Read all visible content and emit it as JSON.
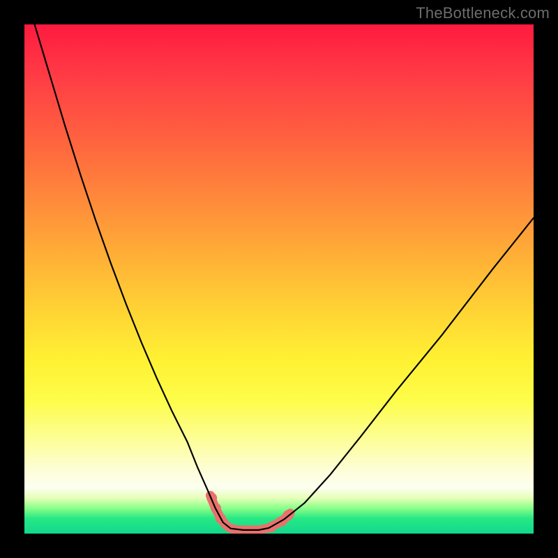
{
  "watermark": "TheBottleneck.com",
  "chart_data": {
    "type": "line",
    "title": "",
    "xlabel": "",
    "ylabel": "",
    "xlim": [
      0,
      100
    ],
    "ylim": [
      0,
      100
    ],
    "grid": false,
    "legend": false,
    "series": [
      {
        "name": "bottleneck-curve",
        "style": "thin-black",
        "x": [
          2,
          5,
          8,
          11,
          14,
          17,
          20,
          23,
          26,
          29,
          32,
          34,
          36,
          37.5,
          39,
          40.5,
          43,
          46,
          48,
          51,
          55,
          60,
          66,
          73,
          82,
          92,
          100
        ],
        "values": [
          100,
          90,
          80,
          70.5,
          61.5,
          53,
          45,
          37.5,
          30.5,
          24,
          18,
          13,
          8.5,
          5,
          2.2,
          1.0,
          0.7,
          0.7,
          1.1,
          2.8,
          6,
          11.5,
          19,
          28,
          39,
          52,
          62
        ]
      },
      {
        "name": "highlight-band",
        "style": "thick-salmon",
        "x": [
          36.5,
          37.5,
          38.5,
          39.5,
          40.5,
          42,
          44,
          46,
          48,
          49.5,
          51,
          52.2
        ],
        "values": [
          7.5,
          5,
          3.1,
          1.7,
          1.0,
          0.7,
          0.7,
          0.7,
          1.1,
          1.9,
          2.8,
          4.0
        ]
      }
    ],
    "markers": [
      {
        "x": 36.8,
        "y": 7.0
      },
      {
        "x": 37.6,
        "y": 5.0
      },
      {
        "x": 38.5,
        "y": 3.0
      },
      {
        "x": 48.5,
        "y": 1.3
      },
      {
        "x": 50.5,
        "y": 2.4
      },
      {
        "x": 51.8,
        "y": 3.6
      }
    ]
  },
  "colors": {
    "curve": "#000000",
    "highlight": "#e9716c",
    "marker": "#e9716c",
    "watermark": "#6d6d6d"
  }
}
